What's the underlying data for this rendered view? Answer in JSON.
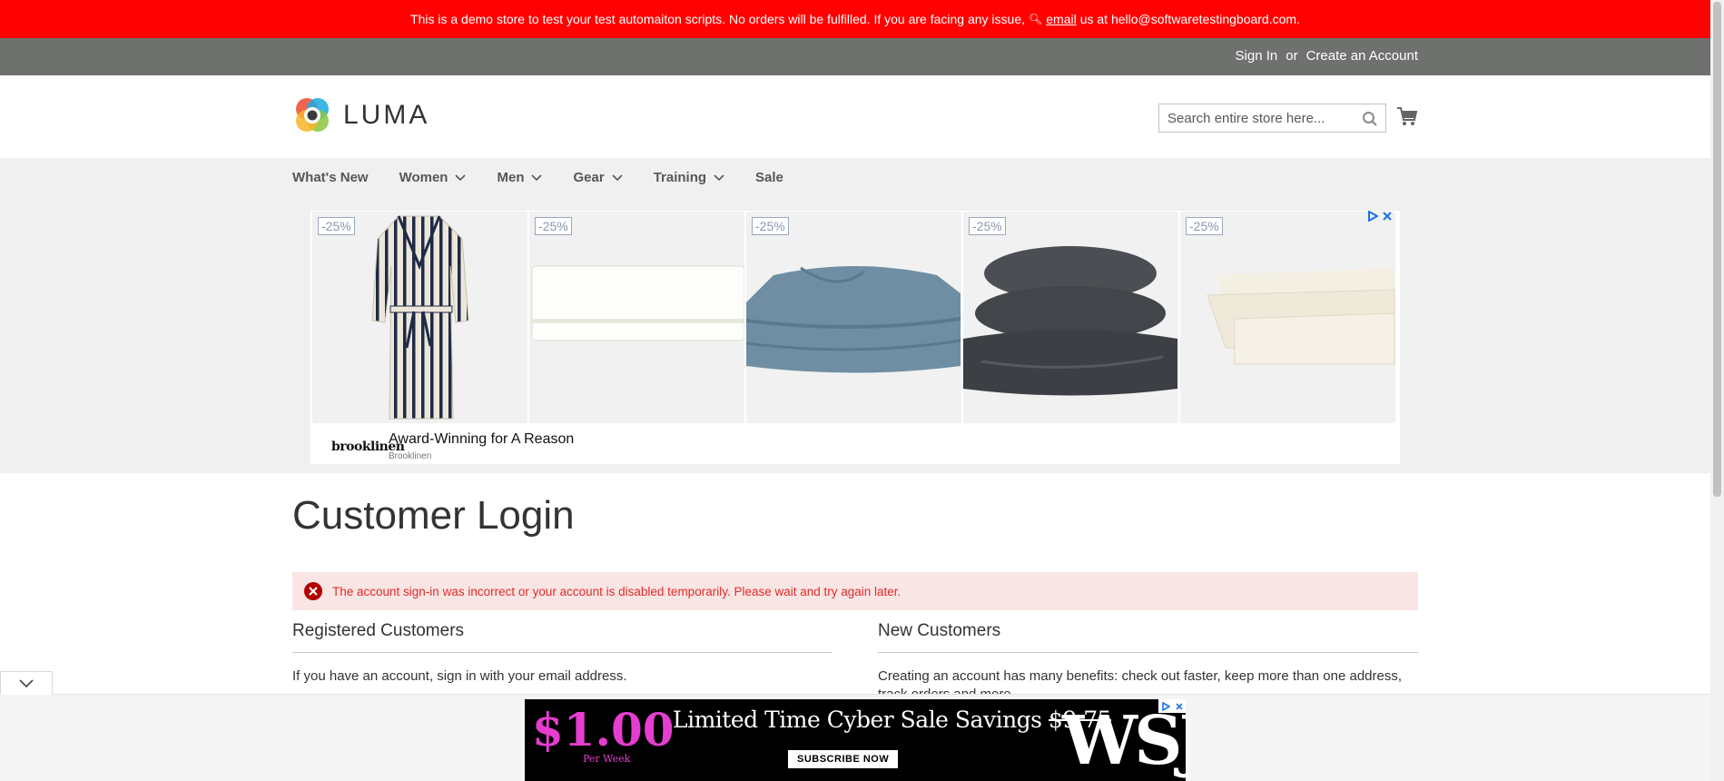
{
  "demo_notice": {
    "text_before": "This is a demo store to test your test automaiton scripts. No orders will be fulfilled. If you are facing any issue,",
    "link_text": "email",
    "text_after": "us at hello@softwaretestingboard.com."
  },
  "header_links": {
    "sign_in": "Sign In",
    "separator": "or",
    "create_account": "Create an Account"
  },
  "logo": {
    "text": "LUMA"
  },
  "search": {
    "placeholder": "Search entire store here..."
  },
  "nav": {
    "items": [
      {
        "label": "What's New",
        "has_dropdown": false
      },
      {
        "label": "Women",
        "has_dropdown": true
      },
      {
        "label": "Men",
        "has_dropdown": true
      },
      {
        "label": "Gear",
        "has_dropdown": true
      },
      {
        "label": "Training",
        "has_dropdown": true
      },
      {
        "label": "Sale",
        "has_dropdown": false
      }
    ]
  },
  "ad": {
    "badges": [
      "-25%",
      "-25%",
      "-25%",
      "-25%",
      "-25%"
    ],
    "brand_logo": "brooklinen",
    "headline": "Award-Winning for A Reason",
    "advertiser": "Brooklinen"
  },
  "page": {
    "title": "Customer Login",
    "error_message": "The account sign-in was incorrect or your account is disabled temporarily. Please wait and try again later."
  },
  "registered": {
    "title": "Registered Customers",
    "text": "If you have an account, sign in with your email address."
  },
  "new_customers": {
    "title": "New Customers",
    "text": "Creating an account has many benefits: check out faster, keep more than one address, track orders and more."
  },
  "bottom_ad": {
    "price": "$1.00",
    "per_week": "Per Week",
    "headline": "Limited Time Cyber Sale Savings",
    "old_price": "$9.75",
    "cta": "SUBSCRIBE NOW",
    "brand": "WSJ"
  },
  "colors": {
    "demo_bar": "#ff0101",
    "panel_header": "#6e716e",
    "error_bg": "#fae5e5",
    "error_text": "#e02b27",
    "nav_bg": "#f0f0f0"
  }
}
